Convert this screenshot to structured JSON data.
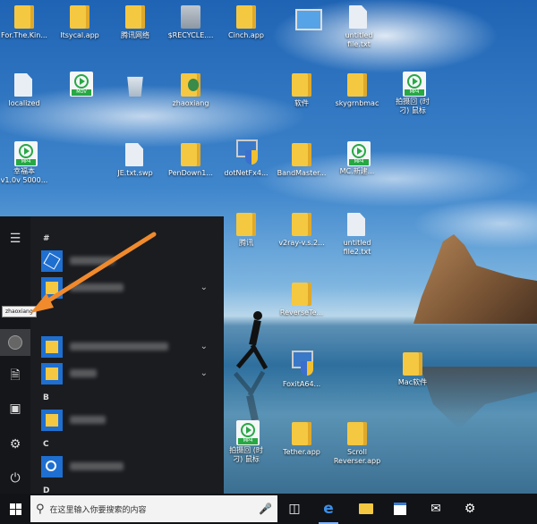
{
  "desktop": {
    "icons": [
      {
        "id": "d1",
        "label": "For.The.Kin...",
        "type": "folder"
      },
      {
        "id": "d2",
        "label": "Itsycal.app",
        "type": "folder"
      },
      {
        "id": "d3",
        "label": "腾讯网络",
        "type": "folder"
      },
      {
        "id": "d4",
        "label": "$RECYCLE....",
        "type": "grey"
      },
      {
        "id": "d5",
        "label": "Cinch.app",
        "type": "folder"
      },
      {
        "id": "d6",
        "label": "",
        "type": "monitor"
      },
      {
        "id": "d7",
        "label": "untitled\nfile.txt",
        "type": "file"
      },
      {
        "id": "d8",
        "label": "localized",
        "type": "file"
      },
      {
        "id": "d9",
        "label": "",
        "type": "mp4"
      },
      {
        "id": "d10",
        "label": "",
        "type": "recycle"
      },
      {
        "id": "d11",
        "label": "zhaoxiang",
        "type": "userfolder"
      },
      {
        "id": "d12",
        "label": "软件",
        "type": "folder"
      },
      {
        "id": "d13",
        "label": "skygrnbmac",
        "type": "folder"
      },
      {
        "id": "d14",
        "label": "拍摄回 (时\n刁) 鼠标",
        "type": "mp4"
      },
      {
        "id": "d15",
        "label": "幸福本\nv1.0v 5000...",
        "type": "mp4"
      },
      {
        "id": "d16",
        "label": "JE.txt.swp",
        "type": "file"
      },
      {
        "id": "d17",
        "label": "PenDown1...",
        "type": "folder"
      },
      {
        "id": "d18",
        "label": "dotNetFx4...",
        "type": "installer"
      },
      {
        "id": "d19",
        "label": "BandMaster...",
        "type": "folder"
      },
      {
        "id": "d20",
        "label": "MC.新建...",
        "type": "mp4"
      },
      {
        "id": "d21",
        "label": "腾讯",
        "type": "folder"
      },
      {
        "id": "d22",
        "label": "v2ray-v.s.2...",
        "type": "folder"
      },
      {
        "id": "d23",
        "label": "untitled\nfile2.txt",
        "type": "file"
      },
      {
        "id": "d24",
        "label": "ReverseTe...",
        "type": "folder"
      },
      {
        "id": "d25",
        "label": "FoxitA64...",
        "type": "installer"
      },
      {
        "id": "d26",
        "label": "Mac软件",
        "type": "folder"
      },
      {
        "id": "d27",
        "label": "拍摄回 (时\n刁) 鼠标",
        "type": "mp4"
      },
      {
        "id": "d28",
        "label": "Tether.app",
        "type": "folder"
      },
      {
        "id": "d29",
        "label": "Scroll\nReverser.app",
        "type": "folder"
      }
    ]
  },
  "start_menu": {
    "section_label": "#",
    "tooltip": "zhaoxiang",
    "groups": [
      {
        "letter": "#"
      },
      {
        "letter": "B"
      },
      {
        "letter": "C"
      },
      {
        "letter": "D"
      }
    ]
  },
  "taskbar": {
    "search_placeholder": "在这里输入你要搜索的内容"
  },
  "colors": {
    "taskbar": "#111317",
    "start_menu": "#1a1c20",
    "tile_blue": "#1f6fd0",
    "annotation_arrow": "#f08a2c"
  }
}
